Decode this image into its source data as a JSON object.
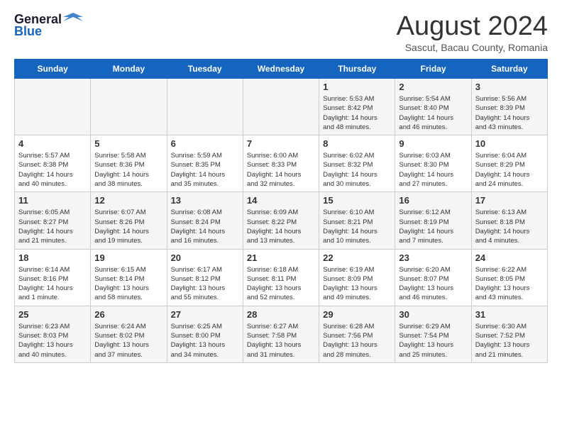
{
  "header": {
    "logo_general": "General",
    "logo_blue": "Blue",
    "title": "August 2024",
    "subtitle": "Sascut, Bacau County, Romania"
  },
  "days_of_week": [
    "Sunday",
    "Monday",
    "Tuesday",
    "Wednesday",
    "Thursday",
    "Friday",
    "Saturday"
  ],
  "weeks": [
    [
      {
        "day": "",
        "info": ""
      },
      {
        "day": "",
        "info": ""
      },
      {
        "day": "",
        "info": ""
      },
      {
        "day": "",
        "info": ""
      },
      {
        "day": "1",
        "info": "Sunrise: 5:53 AM\nSunset: 8:42 PM\nDaylight: 14 hours\nand 48 minutes."
      },
      {
        "day": "2",
        "info": "Sunrise: 5:54 AM\nSunset: 8:40 PM\nDaylight: 14 hours\nand 46 minutes."
      },
      {
        "day": "3",
        "info": "Sunrise: 5:56 AM\nSunset: 8:39 PM\nDaylight: 14 hours\nand 43 minutes."
      }
    ],
    [
      {
        "day": "4",
        "info": "Sunrise: 5:57 AM\nSunset: 8:38 PM\nDaylight: 14 hours\nand 40 minutes."
      },
      {
        "day": "5",
        "info": "Sunrise: 5:58 AM\nSunset: 8:36 PM\nDaylight: 14 hours\nand 38 minutes."
      },
      {
        "day": "6",
        "info": "Sunrise: 5:59 AM\nSunset: 8:35 PM\nDaylight: 14 hours\nand 35 minutes."
      },
      {
        "day": "7",
        "info": "Sunrise: 6:00 AM\nSunset: 8:33 PM\nDaylight: 14 hours\nand 32 minutes."
      },
      {
        "day": "8",
        "info": "Sunrise: 6:02 AM\nSunset: 8:32 PM\nDaylight: 14 hours\nand 30 minutes."
      },
      {
        "day": "9",
        "info": "Sunrise: 6:03 AM\nSunset: 8:30 PM\nDaylight: 14 hours\nand 27 minutes."
      },
      {
        "day": "10",
        "info": "Sunrise: 6:04 AM\nSunset: 8:29 PM\nDaylight: 14 hours\nand 24 minutes."
      }
    ],
    [
      {
        "day": "11",
        "info": "Sunrise: 6:05 AM\nSunset: 8:27 PM\nDaylight: 14 hours\nand 21 minutes."
      },
      {
        "day": "12",
        "info": "Sunrise: 6:07 AM\nSunset: 8:26 PM\nDaylight: 14 hours\nand 19 minutes."
      },
      {
        "day": "13",
        "info": "Sunrise: 6:08 AM\nSunset: 8:24 PM\nDaylight: 14 hours\nand 16 minutes."
      },
      {
        "day": "14",
        "info": "Sunrise: 6:09 AM\nSunset: 8:22 PM\nDaylight: 14 hours\nand 13 minutes."
      },
      {
        "day": "15",
        "info": "Sunrise: 6:10 AM\nSunset: 8:21 PM\nDaylight: 14 hours\nand 10 minutes."
      },
      {
        "day": "16",
        "info": "Sunrise: 6:12 AM\nSunset: 8:19 PM\nDaylight: 14 hours\nand 7 minutes."
      },
      {
        "day": "17",
        "info": "Sunrise: 6:13 AM\nSunset: 8:18 PM\nDaylight: 14 hours\nand 4 minutes."
      }
    ],
    [
      {
        "day": "18",
        "info": "Sunrise: 6:14 AM\nSunset: 8:16 PM\nDaylight: 14 hours\nand 1 minute."
      },
      {
        "day": "19",
        "info": "Sunrise: 6:15 AM\nSunset: 8:14 PM\nDaylight: 13 hours\nand 58 minutes."
      },
      {
        "day": "20",
        "info": "Sunrise: 6:17 AM\nSunset: 8:12 PM\nDaylight: 13 hours\nand 55 minutes."
      },
      {
        "day": "21",
        "info": "Sunrise: 6:18 AM\nSunset: 8:11 PM\nDaylight: 13 hours\nand 52 minutes."
      },
      {
        "day": "22",
        "info": "Sunrise: 6:19 AM\nSunset: 8:09 PM\nDaylight: 13 hours\nand 49 minutes."
      },
      {
        "day": "23",
        "info": "Sunrise: 6:20 AM\nSunset: 8:07 PM\nDaylight: 13 hours\nand 46 minutes."
      },
      {
        "day": "24",
        "info": "Sunrise: 6:22 AM\nSunset: 8:05 PM\nDaylight: 13 hours\nand 43 minutes."
      }
    ],
    [
      {
        "day": "25",
        "info": "Sunrise: 6:23 AM\nSunset: 8:03 PM\nDaylight: 13 hours\nand 40 minutes."
      },
      {
        "day": "26",
        "info": "Sunrise: 6:24 AM\nSunset: 8:02 PM\nDaylight: 13 hours\nand 37 minutes."
      },
      {
        "day": "27",
        "info": "Sunrise: 6:25 AM\nSunset: 8:00 PM\nDaylight: 13 hours\nand 34 minutes."
      },
      {
        "day": "28",
        "info": "Sunrise: 6:27 AM\nSunset: 7:58 PM\nDaylight: 13 hours\nand 31 minutes."
      },
      {
        "day": "29",
        "info": "Sunrise: 6:28 AM\nSunset: 7:56 PM\nDaylight: 13 hours\nand 28 minutes."
      },
      {
        "day": "30",
        "info": "Sunrise: 6:29 AM\nSunset: 7:54 PM\nDaylight: 13 hours\nand 25 minutes."
      },
      {
        "day": "31",
        "info": "Sunrise: 6:30 AM\nSunset: 7:52 PM\nDaylight: 13 hours\nand 21 minutes."
      }
    ]
  ]
}
